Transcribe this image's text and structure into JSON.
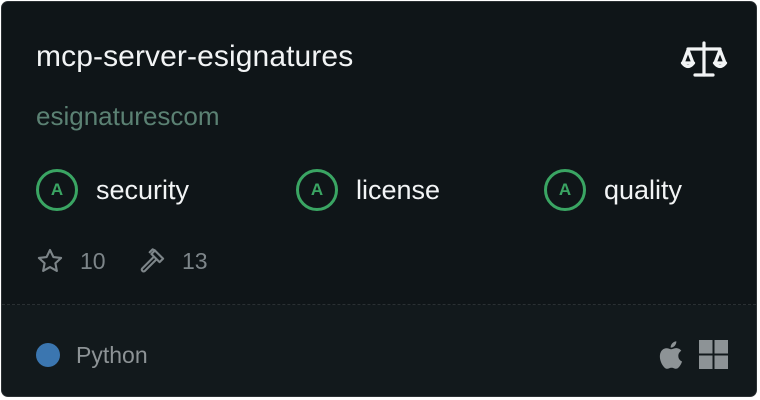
{
  "server": {
    "name": "mcp-server-esignatures",
    "owner": "esignaturescom"
  },
  "grades": [
    {
      "grade": "A",
      "label": "security"
    },
    {
      "grade": "A",
      "label": "license"
    },
    {
      "grade": "A",
      "label": "quality"
    }
  ],
  "stats": {
    "stars": "10",
    "tools": "13"
  },
  "footer": {
    "language": "Python",
    "language_color": "#3b76b0",
    "platforms": [
      "apple-icon",
      "windows-icon"
    ]
  },
  "icons": {
    "license": "scale-icon",
    "stars": "star-icon",
    "tools": "hammer-icon"
  },
  "colors": {
    "card_bg": "#0f1518",
    "grade_green": "#3aa563",
    "owner_text": "#5b8173"
  }
}
